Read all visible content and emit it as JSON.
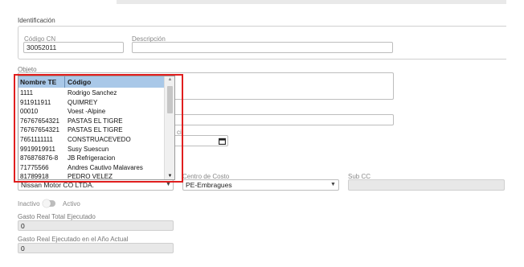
{
  "form": {
    "section_title": "Identificación",
    "codigo_cn": {
      "label": "Código CN",
      "value": "30052011"
    },
    "descripcion": {
      "label": "Descripción",
      "value": ""
    },
    "objeto": {
      "label": "Objeto",
      "value": ""
    },
    "partial_label": "ci",
    "proveedor_value": "Nissan Motor CO LTDA.",
    "centro_costo": {
      "label": "Centro de Costo",
      "value": "PE-Embragues"
    },
    "sub_cc": {
      "label": "Sub CC",
      "value": ""
    },
    "toggle": {
      "off_label": "Inactivo",
      "on_label": "Activo"
    },
    "gasto_total": {
      "label": "Gasto Real Total Ejecutado",
      "value": "0"
    },
    "gasto_anio": {
      "label": "Gasto Real Ejecutado en el Año Actual",
      "value": "0"
    }
  },
  "dropdown": {
    "headers": {
      "col1": "Nombre TE",
      "col2": "Código"
    },
    "rows": [
      {
        "col1": "1111",
        "col2": "Rodrigo Sanchez"
      },
      {
        "col1": "911911911",
        "col2": "QUIMREY"
      },
      {
        "col1": "00010",
        "col2": "Voest -Alpine"
      },
      {
        "col1": "76767654321",
        "col2": "PASTAS EL TIGRE"
      },
      {
        "col1": "76767654321",
        "col2": "PASTAS EL TIGRE"
      },
      {
        "col1": "7651111111",
        "col2": "CONSTRUACEVEDO"
      },
      {
        "col1": "9919919911",
        "col2": "Susy Suescun"
      },
      {
        "col1": "876876876-8",
        "col2": "JB Refrigeracion"
      },
      {
        "col1": "71775566",
        "col2": "Andres Cautivo Malavares"
      },
      {
        "col1": "81789918",
        "col2": "PEDRO VELEZ"
      }
    ]
  },
  "colors": {
    "highlight": "#e01e1e",
    "header_bg": "#a9c8e8"
  }
}
